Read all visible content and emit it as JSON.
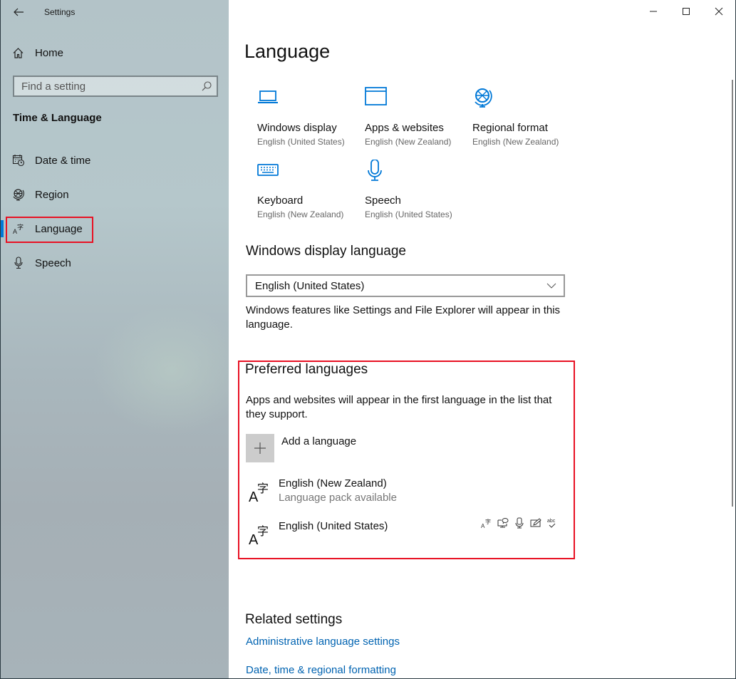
{
  "window": {
    "title": "Settings",
    "controls": {
      "minimize": "minimize",
      "maximize": "maximize",
      "close": "close"
    }
  },
  "sidebar": {
    "home_label": "Home",
    "search": {
      "placeholder": "Find a setting",
      "value": ""
    },
    "section_title": "Time & Language",
    "items": [
      {
        "label": "Date & time",
        "icon": "calendar-clock-icon",
        "active": false
      },
      {
        "label": "Region",
        "icon": "globe-icon",
        "active": false
      },
      {
        "label": "Language",
        "icon": "language-icon",
        "active": true
      },
      {
        "label": "Speech",
        "icon": "microphone-icon",
        "active": false
      }
    ]
  },
  "main": {
    "page_title": "Language",
    "tiles": [
      {
        "label": "Windows display",
        "sub": "English (United States)",
        "icon": "laptop-icon"
      },
      {
        "label": "Apps & websites",
        "sub": "English (New Zealand)",
        "icon": "window-icon"
      },
      {
        "label": "Regional format",
        "sub": "English (New Zealand)",
        "icon": "globe-icon"
      },
      {
        "label": "Keyboard",
        "sub": "English (New Zealand)",
        "icon": "keyboard-icon"
      },
      {
        "label": "Speech",
        "sub": "English (United States)",
        "icon": "microphone-icon"
      }
    ],
    "display_language": {
      "heading": "Windows display language",
      "selected": "English (United States)",
      "description": "Windows features like Settings and File Explorer will appear in this language."
    },
    "preferred_languages": {
      "heading": "Preferred languages",
      "description": "Apps and websites will appear in the first language in the list that they support.",
      "add_label": "Add a language",
      "languages": [
        {
          "name": "English (New Zealand)",
          "status": "Language pack available",
          "features": []
        },
        {
          "name": "English (United States)",
          "status": "",
          "features": [
            "language-pack-icon",
            "text-to-speech-icon",
            "speech-recognition-icon",
            "handwriting-icon",
            "spell-check-icon"
          ]
        }
      ]
    },
    "related": {
      "heading": "Related settings",
      "links": [
        "Administrative language settings",
        "Date, time & regional formatting"
      ]
    }
  },
  "colors": {
    "accent": "#0078d7",
    "link": "#0063b1",
    "highlight": "#e81123"
  }
}
